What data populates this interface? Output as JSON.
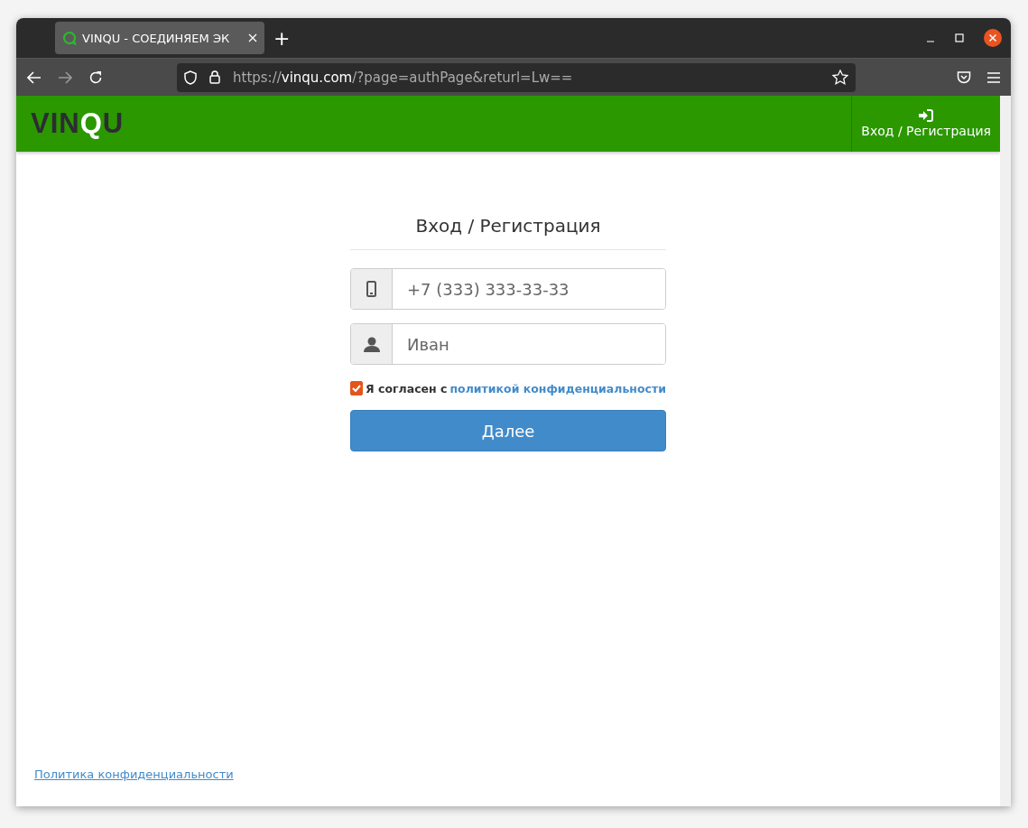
{
  "browser": {
    "tab": {
      "title": "VINQU - СОЕДИНЯЕМ ЭК",
      "selected": true
    },
    "new_tab": "+",
    "url": {
      "scheme": "https://",
      "host": "vinqu.com",
      "path": "/?page=authPage&returl=Lw=="
    }
  },
  "header": {
    "logo": [
      {
        "text": "VIN",
        "highlight": false
      },
      {
        "text": "Q",
        "highlight": true
      },
      {
        "text": "U",
        "highlight": false
      }
    ],
    "login_link": "Вход / Регистрация"
  },
  "form": {
    "title": "Вход / Регистрация",
    "fields": [
      {
        "kind": "phone",
        "placeholder": "+7 (333) 333-33-33"
      },
      {
        "kind": "person",
        "placeholder": "Иван"
      }
    ],
    "consent": {
      "checked": true,
      "text": "Я согласен с",
      "link": "политикой конфиденциальности"
    },
    "submit": "Далее"
  },
  "footer": {
    "link": "Политика конфиденциальности"
  }
}
